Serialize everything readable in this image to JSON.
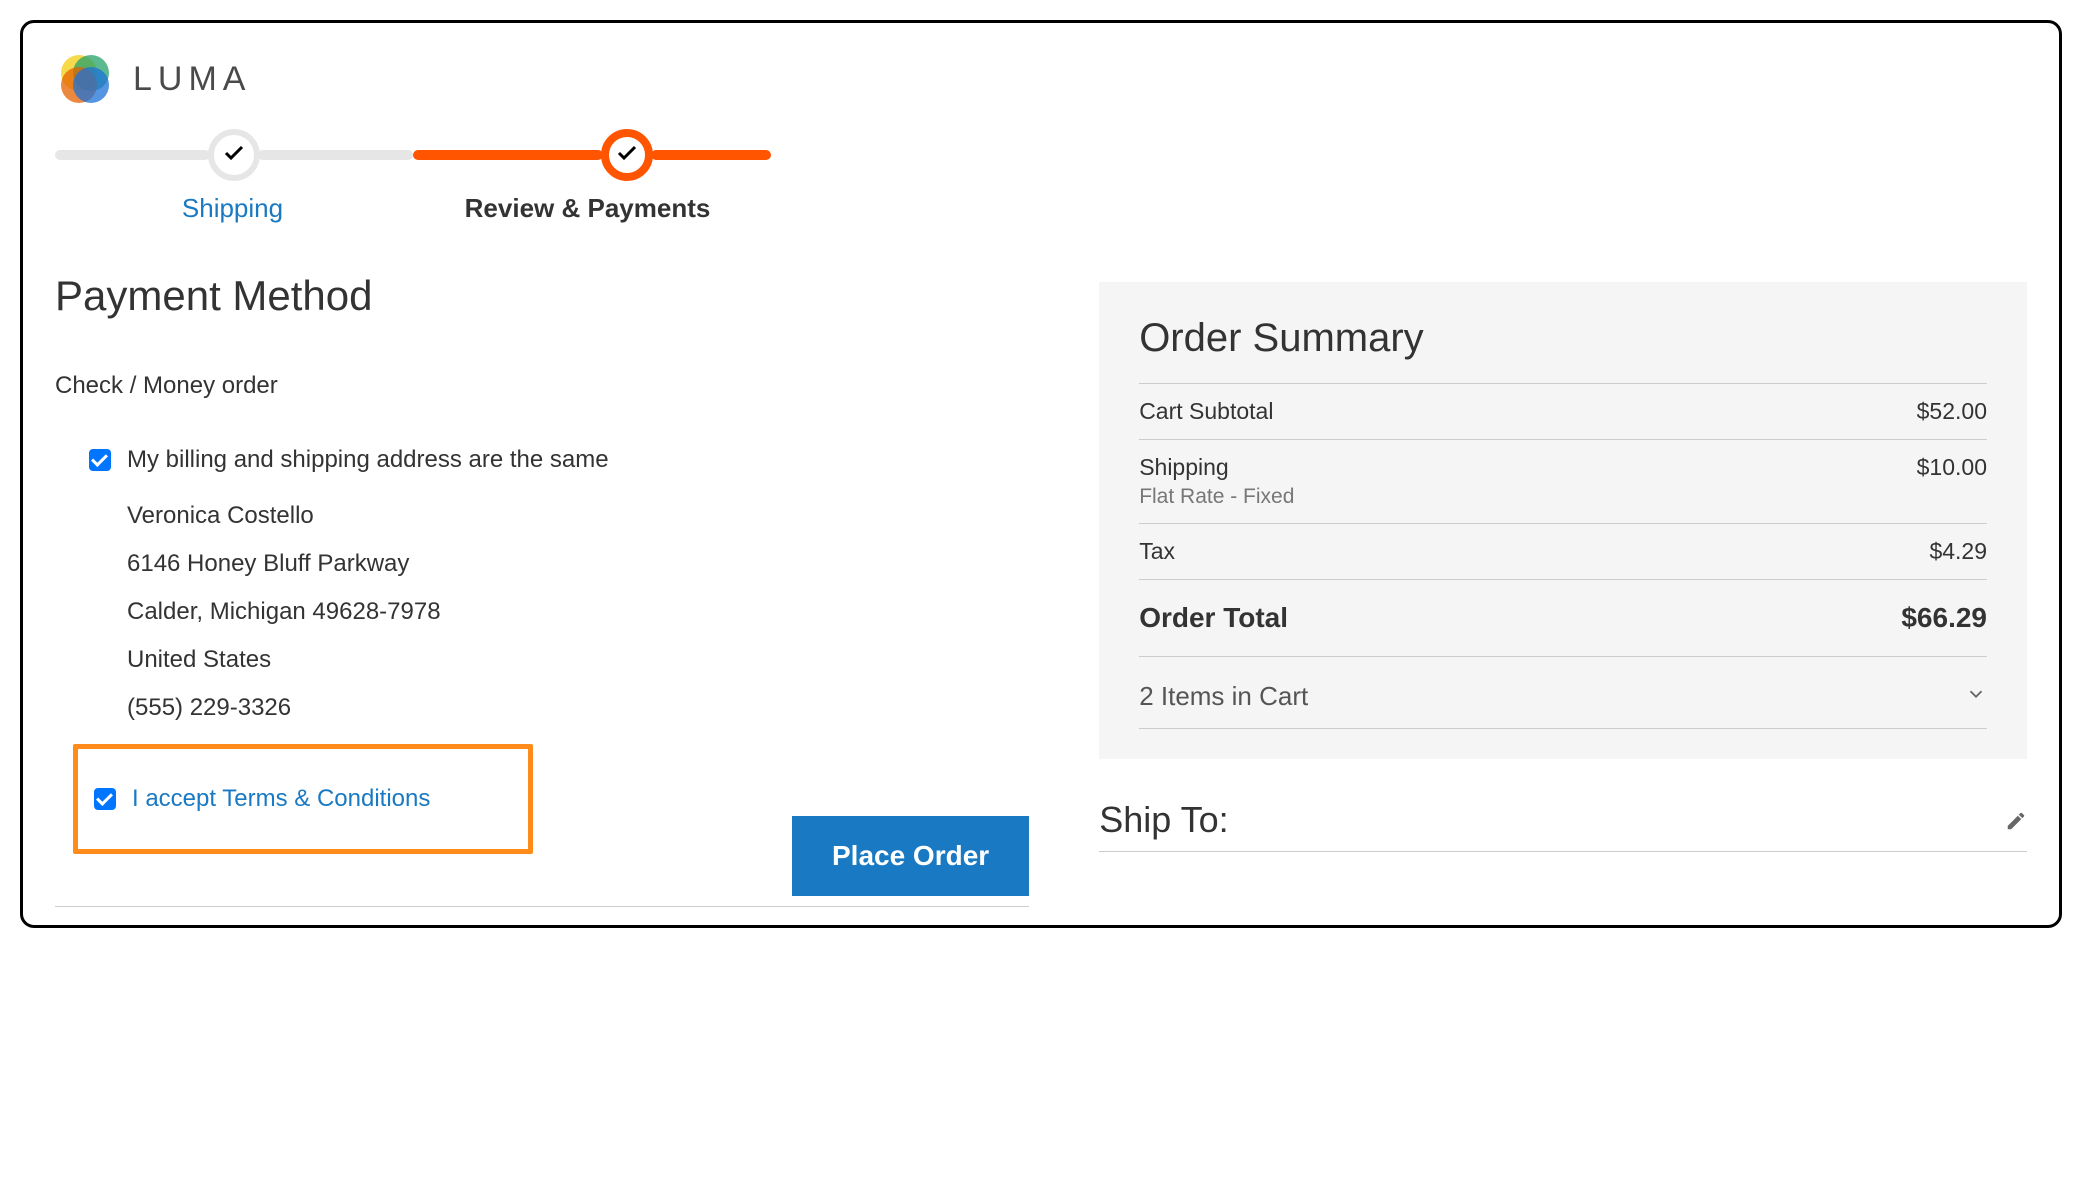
{
  "brand": {
    "name": "LUMA"
  },
  "progress": {
    "step1_label": "Shipping",
    "step2_label": "Review & Payments"
  },
  "payment": {
    "section_title": "Payment Method",
    "method_name": "Check / Money order",
    "same_address_label": "My billing and shipping address are the same",
    "same_address_checked": true,
    "address": {
      "name": "Veronica Costello",
      "street": "6146 Honey Bluff Parkway",
      "city_region_postal": "Calder, Michigan 49628-7978",
      "country": "United States",
      "phone": "(555) 229-3326"
    },
    "terms_label": "I accept Terms & Conditions",
    "terms_checked": true,
    "place_order_label": "Place Order"
  },
  "summary": {
    "title": "Order Summary",
    "rows": {
      "subtotal_label": "Cart Subtotal",
      "subtotal_value": "$52.00",
      "shipping_label": "Shipping",
      "shipping_sub": "Flat Rate - Fixed",
      "shipping_value": "$10.00",
      "tax_label": "Tax",
      "tax_value": "$4.29",
      "total_label": "Order Total",
      "total_value": "$66.29"
    },
    "cart_toggle_label": "2 Items in Cart",
    "ship_to_label": "Ship To:"
  }
}
